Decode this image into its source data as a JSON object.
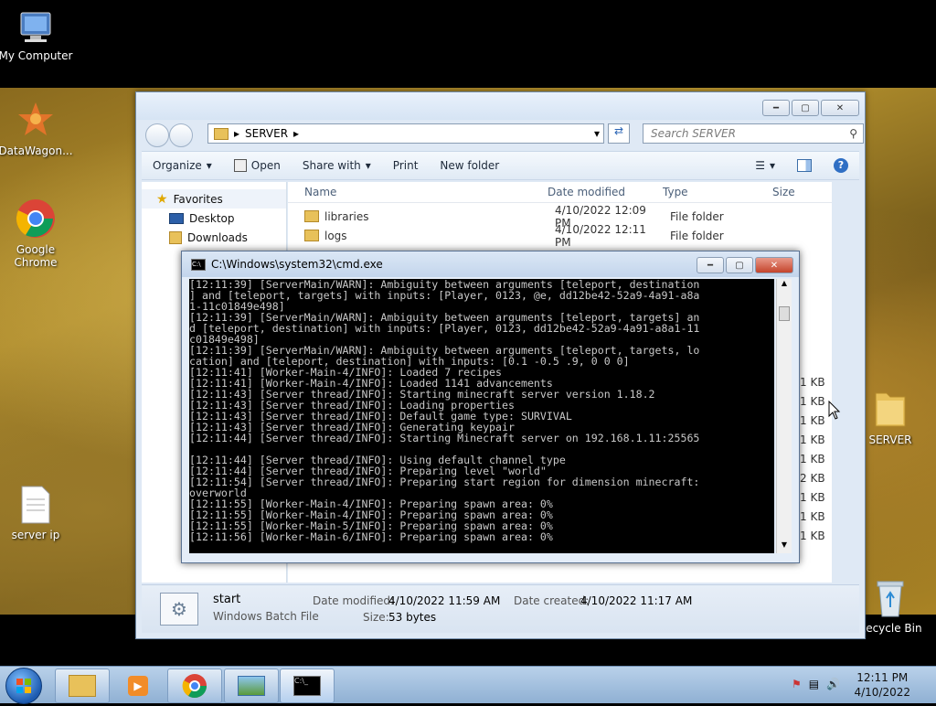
{
  "desktop": {
    "icons": [
      {
        "label": "My Computer"
      },
      {
        "label": "DataWagon..."
      },
      {
        "label": "Google Chrome"
      },
      {
        "label": "server ip"
      },
      {
        "label": "SERVER"
      },
      {
        "label": "Recycle Bin"
      }
    ]
  },
  "explorer": {
    "address": "SERVER",
    "search_placeholder": "Search SERVER",
    "toolbar": {
      "organize": "Organize",
      "open": "Open",
      "share": "Share with",
      "print": "Print",
      "new_folder": "New folder"
    },
    "nav": {
      "favorites": "Favorites",
      "desktop": "Desktop",
      "downloads": "Downloads"
    },
    "columns": {
      "name": "Name",
      "date": "Date modified",
      "type": "Type",
      "size": "Size"
    },
    "rows": [
      {
        "name": "libraries",
        "date": "4/10/2022 12:09 PM",
        "type": "File folder"
      },
      {
        "name": "logs",
        "date": "4/10/2022 12:11 PM",
        "type": "File folder"
      }
    ],
    "sizes": [
      "1 KB",
      "1 KB",
      "1 KB",
      "1 KB",
      "1 KB",
      "2 KB",
      "1 KB",
      "1 KB",
      "1 KB"
    ],
    "details": {
      "name": "start",
      "type": "Windows Batch File",
      "modified_label": "Date modified:",
      "modified": "4/10/2022 11:59 AM",
      "created_label": "Date created:",
      "created": "4/10/2022 11:17 AM",
      "size_label": "Size:",
      "size": "53 bytes"
    }
  },
  "cmd": {
    "title": "C:\\Windows\\system32\\cmd.exe",
    "output": "[12:11:39] [ServerMain/WARN]: Ambiguity between arguments [teleport, destination\n] and [teleport, targets] with inputs: [Player, 0123, @e, dd12be42-52a9-4a91-a8a\n1-11c01849e498]\n[12:11:39] [ServerMain/WARN]: Ambiguity between arguments [teleport, targets] an\nd [teleport, destination] with inputs: [Player, 0123, dd12be42-52a9-4a91-a8a1-11\nc01849e498]\n[12:11:39] [ServerMain/WARN]: Ambiguity between arguments [teleport, targets, lo\ncation] and [teleport, destination] with inputs: [0.1 -0.5 .9, 0 0 0]\n[12:11:41] [Worker-Main-4/INFO]: Loaded 7 recipes\n[12:11:41] [Worker-Main-4/INFO]: Loaded 1141 advancements\n[12:11:43] [Server thread/INFO]: Starting minecraft server version 1.18.2\n[12:11:43] [Server thread/INFO]: Loading properties\n[12:11:43] [Server thread/INFO]: Default game type: SURVIVAL\n[12:11:43] [Server thread/INFO]: Generating keypair\n[12:11:44] [Server thread/INFO]: Starting Minecraft server on 192.168.1.11:25565\n\n[12:11:44] [Server thread/INFO]: Using default channel type\n[12:11:44] [Server thread/INFO]: Preparing level \"world\"\n[12:11:54] [Server thread/INFO]: Preparing start region for dimension minecraft:\noverworld\n[12:11:55] [Worker-Main-4/INFO]: Preparing spawn area: 0%\n[12:11:55] [Worker-Main-4/INFO]: Preparing spawn area: 0%\n[12:11:55] [Worker-Main-5/INFO]: Preparing spawn area: 0%\n[12:11:56] [Worker-Main-6/INFO]: Preparing spawn area: 0%"
  },
  "taskbar": {
    "time": "12:11 PM",
    "date": "4/10/2022"
  }
}
